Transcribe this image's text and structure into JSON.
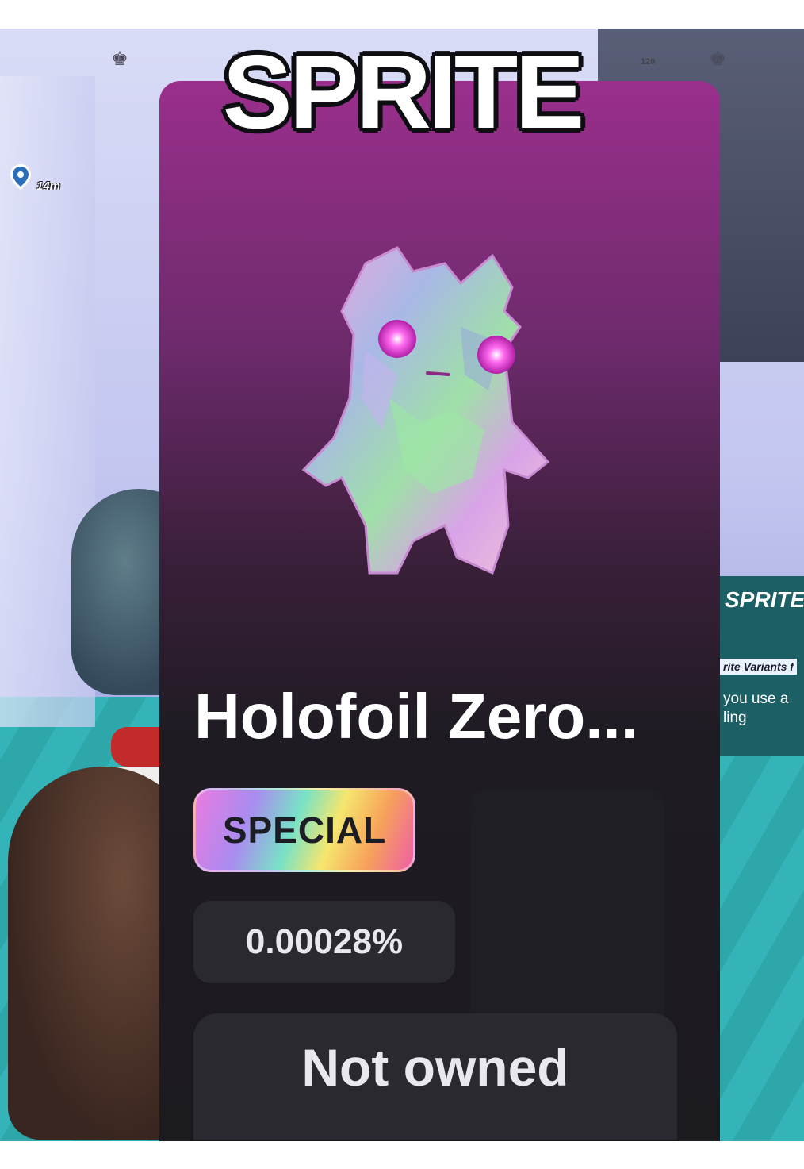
{
  "overlay": {
    "caption": "SPRITE"
  },
  "hud": {
    "marker_distance": "14m",
    "small_counter": "120",
    "icons": [
      "crown-icon",
      "crown-icon",
      "crown-icon"
    ]
  },
  "side_panel": {
    "title": "SPRITE",
    "subtitle": "rite Variants f",
    "line1": "you use a",
    "line2": "ling"
  },
  "card": {
    "item_name": "Holofoil Zero...",
    "rarity": "SPECIAL",
    "drop_chance": "0.00028%",
    "ownership": "Not owned",
    "colors": {
      "card_top": "#9a2f8c",
      "card_bottom": "#1b1a1f",
      "panel_bg": "#2a292f"
    }
  }
}
